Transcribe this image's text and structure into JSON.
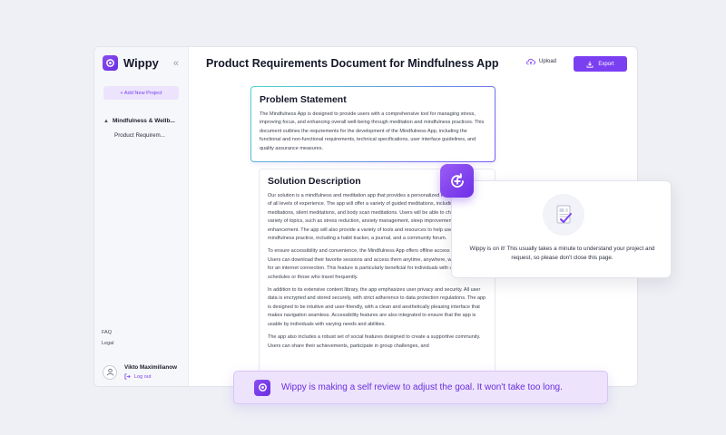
{
  "app": {
    "name": "Wippy"
  },
  "sidebar": {
    "new_project_label": "+ Add New Project",
    "group_label": "Mindfulness & Wellb...",
    "doc_item_label": "Product Requirem...",
    "faq_label": "FAQ",
    "legal_label": "Legal",
    "user_name": "Vikto Maximilianow",
    "logout_label": "Log out"
  },
  "header": {
    "title": "Product Requirements Document for Mindfulness App",
    "upload_label": "Upload",
    "export_label": "Export"
  },
  "problem": {
    "heading": "Problem Statement",
    "body": "The Mindfulness App is designed to provide users with a comprehensive tool for managing stress, improving focus, and enhancing overall well-being through meditation and mindfulness practices. This document outlines the requirements for the development of the Mindfulness App, including the functional and non-functional requirements, technical specifications, user interface guidelines, and quality assurance measures."
  },
  "solution": {
    "heading": "Solution Description",
    "paragraphs": [
      "Our solution is a mindfulness and meditation app that provides a personalized experience for users of all levels of experience. The app will offer a variety of guided meditations, including guided meditations, silent meditations, and body scan meditations. Users will be able to choose from a variety of topics, such as stress reduction, anxiety management, sleep improvement, and focus enhancement. The app will also provide a variety of tools and resources to help users build a mindfulness practice, including a habit tracker, a journal, and a community forum.",
      "To ensure accessibility and convenience, the Mindfulness App offers offline access to its content. Users can download their favorite sessions and access them anytime, anywhere, without the need for an internet connection. This feature is particularly beneficial for individuals with unpredictable schedules or those who travel frequently.",
      "In addition to its extensive content library, the app emphasizes user privacy and security. All user data is encrypted and stored securely, with strict adherence to data protection regulations. The app is designed to be intuitive and user-friendly, with a clean and aesthetically pleasing interface that makes navigation seamless. Accessibility features are also integrated to ensure that the app is usable by individuals with varying needs and abilities.",
      "The app also includes a robust set of social features designed to create a supportive community. Users can share their achievements, participate in group challenges, and"
    ]
  },
  "status": {
    "message": "Wippy is on it! This usually takes a minute to understand your project and request, so please don't close this page."
  },
  "toast": {
    "message": "Wippy is making a self review to adjust the goal. It won't take too long."
  },
  "icons": {
    "logo": "wippy-logo-icon",
    "collapse": "double-chevron-left-icon",
    "group": "chevron-up-icon",
    "avatar": "user-icon",
    "logout": "logout-icon",
    "upload": "cloud-upload-icon",
    "export": "download-icon",
    "floater": "refresh-icon",
    "status": "document-check-icon"
  },
  "colors": {
    "accent": "#7b3ff2",
    "accent_light": "#ede3fc",
    "border_gradient_start": "#4fd6c8",
    "border_gradient_end": "#7a5af8"
  }
}
